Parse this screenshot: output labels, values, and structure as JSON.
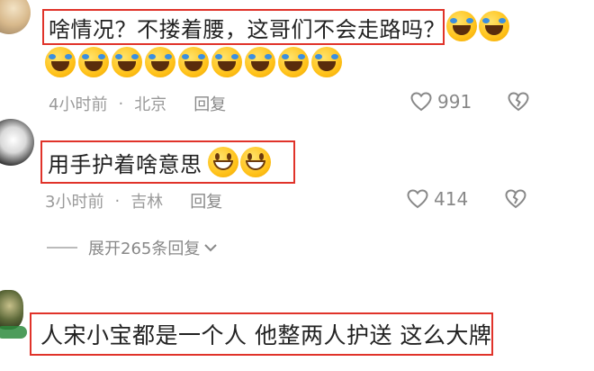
{
  "comments": [
    {
      "text": "啥情况？不搂着腰，这哥们不会走路吗？",
      "time": "4小时前",
      "location": "北京",
      "reply_label": "回复",
      "likes": "991",
      "emoji_name": "laughing-crying-emoji"
    },
    {
      "text": "用手护着啥意思",
      "time": "3小时前",
      "location": "吉林",
      "reply_label": "回复",
      "likes": "414",
      "emoji_name": "grinning-emoji"
    },
    {
      "text": "人宋小宝都是一个人 他整两人护送 这么大牌"
    }
  ],
  "expand_replies": "展开265条回复",
  "colors": {
    "highlight_border": "#e0332a",
    "meta": "#9a9a9a"
  }
}
